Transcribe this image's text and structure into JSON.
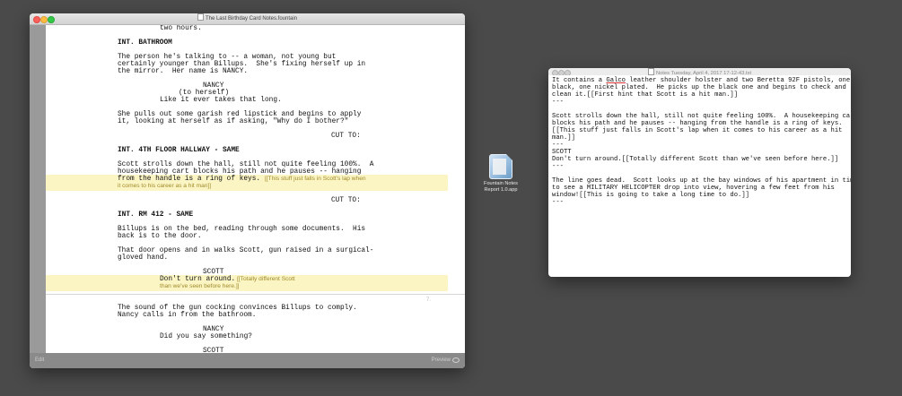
{
  "editor": {
    "title": "The Last Birthday Card Notes.fountain",
    "status_left": "Edit",
    "status_right": "Preview",
    "lines": {
      "l01": "two hours.",
      "l02": "INT. BATHROOM",
      "l03": "The person he's talking to -- a woman, not young but",
      "l04": "certainly younger than Billups.  She's fixing herself up in",
      "l05": "the mirror.  Her name is NANCY.",
      "l06": "NANCY",
      "l07": "(to herself)",
      "l08": "Like it ever takes that long.",
      "l09": "She pulls out some garish red lipstick and begins to apply",
      "l10": "it, looking at herself as if asking, \"Why do I bother?\"",
      "l11": "CUT TO:",
      "l12": "INT. 4TH FLOOR HALLWAY - SAME",
      "l13": "Scott strolls down the hall, still not quite feeling 100%.  A",
      "l14": "housekeeping cart blocks his path and he pauses -- hanging",
      "l15": "from the handle is a ring of keys.",
      "l15n": "[[This stuff just falls in Scott's lap when",
      "l16n": "it comes to his career as a hit man]]",
      "l17": "CUT TO:",
      "l18": "INT. RM 412 - SAME",
      "l19": "Billups is on the bed, reading through some documents.  His",
      "l20": "back is to the door.",
      "l21": "That door opens and in walks Scott, gun raised in a surgical-",
      "l22": "gloved hand.",
      "l23": "SCOTT",
      "l24": "Don't turn around.",
      "l24n": "[[Totally different Scott",
      "l25n": "than we've seen before here.]]",
      "pagenum": "7.",
      "l26": "The sound of the gun cocking convinces Billups to comply.",
      "l27": "Nancy calls in from the bathroom.",
      "l28": "NANCY",
      "l29": "Did you say something?",
      "l30": "SCOTT"
    }
  },
  "desktop_icon": {
    "label_1": "Fountain Notes",
    "label_2": "Report 1.0.app",
    "icon": "fountain-app-icon"
  },
  "notes": {
    "title": "Notes Tuesday, April 4, 2017 17-12-43.txt",
    "lines": {
      "n01a": "It contains a ",
      "n01b": "Galco",
      "n01c": " leather shoulder holster and two Beretta 92F pistols, one",
      "n02": "black, one nickel plated.  He picks up the black one and begins to check and",
      "n03": "clean it.[[First hint that Scott is a hit man.]]",
      "n04": "---",
      "n05": "Scott strolls down the hall, still not quite feeling 100%.  A housekeeping cart",
      "n06": "blocks his path and he pauses -- hanging from the handle is a ring of keys.",
      "n07": "[[This stuff just falls in Scott's lap when it comes to his career as a hit",
      "n08": "man.]]",
      "n09": "---",
      "n10": "SCOTT",
      "n11": "Don't turn around.[[Totally different Scott than we've seen before here.]]",
      "n12": "---",
      "n13": "The line goes dead.  Scott looks up at the bay windows of his apartment in time",
      "n14": "to see a MILITARY HELICOPTER drop into view, hovering a few feet from his",
      "n15": "window![[This is going to take a long time to do.]]",
      "n16": "---"
    }
  }
}
